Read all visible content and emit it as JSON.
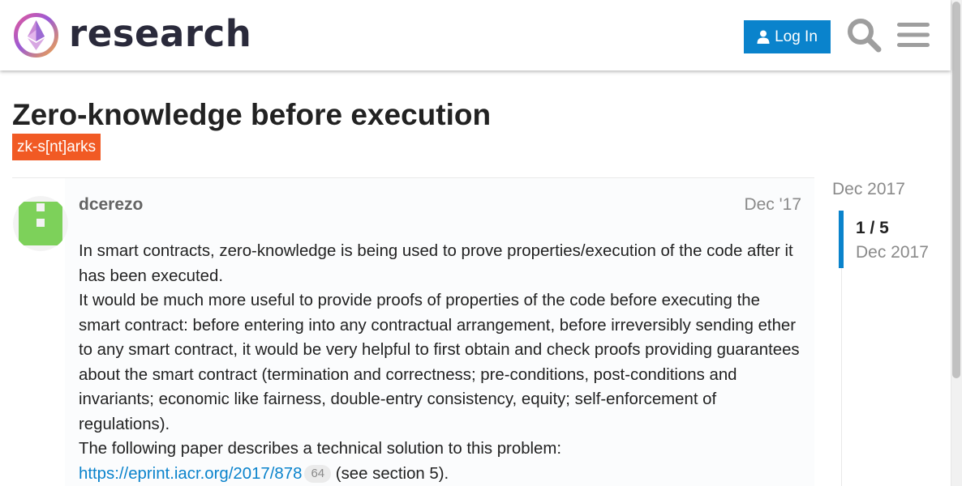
{
  "header": {
    "logo_text": "research",
    "login_label": "Log In",
    "search_icon": "search-icon",
    "menu_icon": "hamburger-menu-icon"
  },
  "topic": {
    "title": "Zero-knowledge before execution",
    "category": "zk-s[nt]arks"
  },
  "post": {
    "username": "dcerezo",
    "date": "Dec '17",
    "paragraphs": [
      "In smart contracts, zero-knowledge is being used to prove properties/execution of the code after it has been executed.",
      "It would be much more useful to provide proofs of properties of the code before executing the smart contract: before entering into any contractual arrangement, before irreversibly sending ether to any smart contract, it would be very helpful to first obtain and check proofs providing guarantees about the smart contract (termination and correctness; pre-conditions, post-conditions and invariants; economic like fairness, double-entry consistency, equity; self-enforcement of regulations).",
      "The following paper describes a technical solution to this problem:"
    ],
    "link_text": "https://eprint.iacr.org/2017/878",
    "link_clicks": "64",
    "link_suffix": " (see section 5)."
  },
  "timeline": {
    "start_date": "Dec 2017",
    "progress": "1 / 5",
    "current_date": "Dec 2017"
  },
  "colors": {
    "accent": "#0a83cc",
    "category": "#f15a24",
    "avatar": "#7dd15a"
  }
}
